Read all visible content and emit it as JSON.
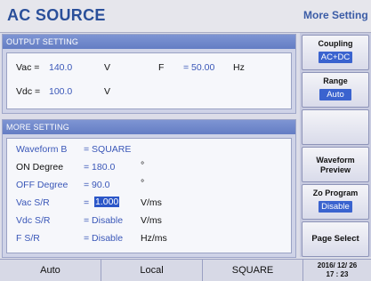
{
  "header": {
    "title": "AC SOURCE",
    "softkey_title": "More Setting"
  },
  "output_setting": {
    "title": "OUTPUT SETTING",
    "vac_label": "Vac =",
    "vac_value": "140.0",
    "vac_unit": "V",
    "f_label": "F",
    "f_value": "= 50.00",
    "f_unit": "Hz",
    "vdc_label": "Vdc =",
    "vdc_value": "100.0",
    "vdc_unit": "V"
  },
  "more_setting": {
    "title": "MORE SETTING",
    "rows": [
      {
        "label": "Waveform B",
        "value": "= SQUARE",
        "unit": ""
      },
      {
        "label": "ON Degree",
        "value": "= 180.0",
        "unit": "°"
      },
      {
        "label": "OFF Degree",
        "value": "= 90.0",
        "unit": "°"
      },
      {
        "label": "Vac S/R",
        "value_prefix": "=",
        "value": "1.000",
        "unit": "V/ms"
      },
      {
        "label": "Vdc S/R",
        "value": "= Disable",
        "unit": "V/ms"
      },
      {
        "label": "F S/R",
        "value": "= Disable",
        "unit": "Hz/ms"
      }
    ]
  },
  "softkeys": [
    {
      "label": "Coupling",
      "value": "AC+DC"
    },
    {
      "label": "Range",
      "value": "Auto"
    },
    {
      "label": "",
      "value": ""
    },
    {
      "label": "Waveform",
      "label2": "Preview",
      "value": ""
    },
    {
      "label": "Zo Program",
      "value": "Disable"
    },
    {
      "label": "Page Select",
      "value": ""
    }
  ],
  "status": {
    "mode": "Auto",
    "control": "Local",
    "waveform": "SQUARE",
    "date": "2016/ 12/ 26",
    "time": "17 : 23"
  }
}
